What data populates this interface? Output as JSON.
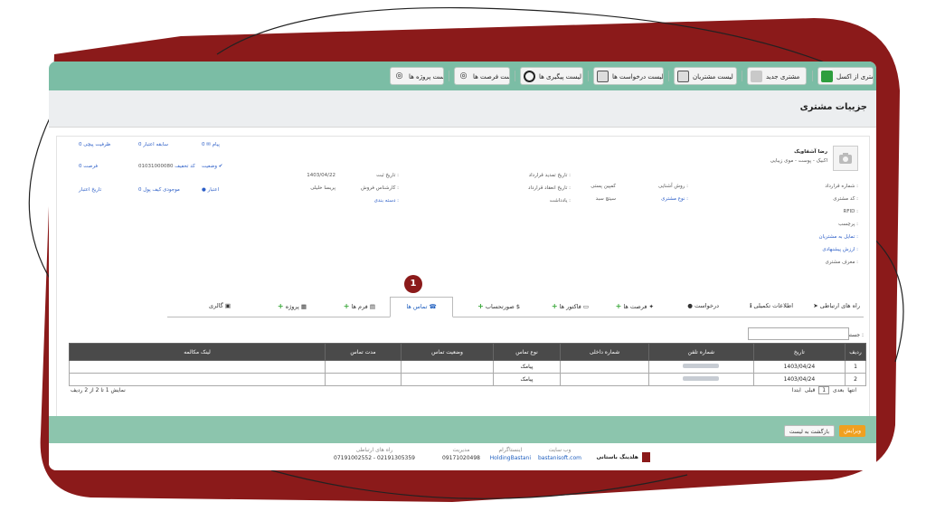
{
  "toolbar": {
    "items": [
      {
        "label": "ثبت مشتری از اکسل",
        "icon": "excel-icon",
        "color": "#2e9e3e"
      },
      {
        "label": "مشتری جدید",
        "icon": "add-user-icon",
        "color": "#6a6a6a"
      },
      {
        "label": "لیست مشتریان",
        "icon": "list-icon",
        "color": "#555555"
      },
      {
        "label": "لیست درخواست ها",
        "icon": "calculator-icon",
        "color": "#555555"
      },
      {
        "label": "لیست پیگیری ها",
        "icon": "clock-icon",
        "color": "#222222"
      },
      {
        "label": "لیست فرصت ها",
        "icon": "lightbulb-icon",
        "color": "#888888"
      },
      {
        "label": "لیست پروژه ها",
        "icon": "lightbulb-icon",
        "color": "#888888"
      }
    ]
  },
  "page": {
    "title": "جزییات مشتری"
  },
  "customer": {
    "name": "رضا آشفاویک",
    "category": "اکبیک - پوست - موی زیبایی",
    "left_labels": [
      "شماره قرارداد :",
      "کد مشتری :",
      "RFID :",
      "پرچسب :",
      "تمایل به مشتریان :",
      "ارزش پیشنهادی :",
      "معرف مشتری :"
    ],
    "mid_labels": [
      "روش آشنایی :",
      "نوع مشتری :"
    ],
    "mid_values": [
      "کمپین پستی",
      "سیتچ سبد"
    ],
    "contract_labels": [
      "تاریخ تمدید قرارداد :",
      "تاریخ انعقاد قرارداد :",
      "یادداشت :"
    ],
    "reg_labels": [
      "تاریخ ثبت :",
      "کارشناس فروش :",
      "دسته بندی :"
    ],
    "reg_values": [
      "1403/04/22",
      "پریسا خلیلی"
    ],
    "stat_items": [
      {
        "label": "پیام",
        "value": "0"
      },
      {
        "label": "سابقه اعتبار",
        "value": "0"
      },
      {
        "label": "ظرفیت پیچی",
        "value": "0"
      },
      {
        "label": "وضعیت",
        "value": ""
      },
      {
        "label": "کد تخفیف",
        "value": "01031000080"
      },
      {
        "label": "فرصت",
        "value": "0"
      },
      {
        "label": "اعتبار",
        "value": ""
      },
      {
        "label": "موجودی کیف پول",
        "value": "0"
      },
      {
        "label": "تاریخ اعتبار",
        "value": ""
      }
    ]
  },
  "badge": "1",
  "tabs": [
    {
      "label": "راه های ارتباطی",
      "icon": "send-icon"
    },
    {
      "label": "اطلاعات تکمیلی",
      "icon": "info-icon"
    },
    {
      "label": "درخواست",
      "icon": "chat-icon"
    },
    {
      "label": "فرصت ها",
      "icon": "megaphone-icon",
      "plus": true
    },
    {
      "label": "فاکتور ها",
      "icon": "card-icon",
      "plus": true
    },
    {
      "label": "صورتحساب",
      "icon": "dollar-icon",
      "plus": true
    },
    {
      "label": "تماس ها",
      "icon": "phone-icon",
      "active": true
    },
    {
      "label": "فرم ها",
      "icon": "form-icon",
      "plus": true
    },
    {
      "label": "پروژه",
      "icon": "list-icon",
      "plus": true
    },
    {
      "label": "گالری",
      "icon": "image-icon"
    }
  ],
  "search": {
    "label": "جستجو :",
    "placeholder": ""
  },
  "table": {
    "headers": [
      "ردیف",
      "تاریخ",
      "شماره تلفن",
      "شماره داخلی",
      "نوع تماس",
      "وضعیت تماس",
      "مدت تماس",
      "لینک مکالمه"
    ],
    "rows": [
      [
        "1",
        "1403/04/24",
        "",
        "",
        "پیامک",
        "",
        "",
        ""
      ],
      [
        "2",
        "1403/04/24",
        "",
        "",
        "پیامک",
        "",
        "",
        ""
      ]
    ]
  },
  "pager": {
    "first": "ابتدا",
    "prev": "قبلی",
    "page": "1",
    "next": "بعدی",
    "last": "انتها"
  },
  "summary": "نمایش 1 تا 2 از 2 ردیف",
  "actions": {
    "edit": "ویرایش",
    "back": "بازگشت به لیست"
  },
  "footer": {
    "brand": "هلدینگ باستانی",
    "website_label": "وب سایت",
    "website": "bastanisoft.com",
    "instagram_label": "اینستاگرام",
    "instagram": "HoldingBastani",
    "management_label": "مدیریت",
    "management": "09171020498",
    "contact_label": "راه های ارتباطی",
    "contact": "07191002552 - 02191305359"
  },
  "colors": {
    "frame": "#8b1a1a",
    "toolbar": "#7bbda5",
    "actionbar": "#8cc5ad",
    "accent": "#f0a020",
    "link": "#1f5fbf"
  }
}
